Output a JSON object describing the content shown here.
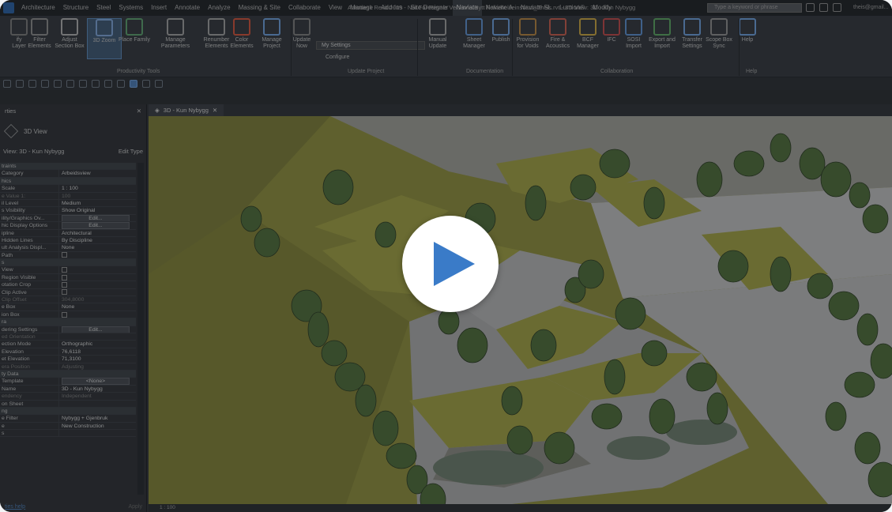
{
  "titlebar": {
    "tabs": [
      "Architecture",
      "Structure",
      "Steel",
      "Systems",
      "Insert",
      "Annotate",
      "Analyze",
      "Massing & Site",
      "Collaborate",
      "View",
      "Manage",
      "Add-Ins",
      "Site Designer",
      "Naviate",
      "Naviate A",
      "Naviate SL",
      "Lumion®",
      "Modify"
    ],
    "active_tab": "Naviate",
    "window_title": "Autodesk Revit 2019 - Not For Resale Version - Nytt Folkehelseinstitutt_Theis.rvt - 3D View: 3D - Kun Nybygg",
    "search_placeholder": "Type a keyword or phrase",
    "user": "theis@gmail..."
  },
  "ribbon": {
    "buttons": [
      {
        "label": "ify\nLayer",
        "icon": "modify-icon"
      },
      {
        "label": "Filter\nElements",
        "icon": "filter-icon"
      },
      {
        "label": "Adjust\nSection Box",
        "icon": "section-box-icon"
      },
      {
        "label": "3D Zoom",
        "icon": "3d-zoom-icon"
      },
      {
        "label": "Place Family",
        "icon": "place-family-icon"
      },
      {
        "label": "Manage\nParameters",
        "icon": "parameters-icon"
      },
      {
        "label": "Renumber\nElements",
        "icon": "renumber-icon"
      },
      {
        "label": "Color\nElements",
        "icon": "color-wheel-icon"
      },
      {
        "label": "Manage\nProject",
        "icon": "gear-icon"
      },
      {
        "label": "Update\nNow",
        "icon": "update-icon"
      },
      {
        "label": "Manual\nUpdate",
        "icon": "manual-update-icon"
      },
      {
        "label": "Sheet\nManager",
        "icon": "sheet-manager-icon"
      },
      {
        "label": "Publish",
        "icon": "publish-icon"
      },
      {
        "label": "Provision\nfor Voids",
        "icon": "provision-icon"
      },
      {
        "label": "Fire &\nAcoustics",
        "icon": "fire-icon"
      },
      {
        "label": "BCF\nManager",
        "icon": "bcf-icon"
      },
      {
        "label": "IFC",
        "icon": "ifc-icon"
      },
      {
        "label": "SOSI\nImport",
        "icon": "sosi-icon"
      },
      {
        "label": "Export and\nImport",
        "icon": "export-import-icon"
      },
      {
        "label": "Transfer\nSettings",
        "icon": "transfer-icon"
      },
      {
        "label": "Scope Box\nSync",
        "icon": "scope-box-icon"
      },
      {
        "label": "Help",
        "icon": "help-icon"
      }
    ],
    "settings_dropdown": "My Settings",
    "configure_label": "Configure",
    "panels": [
      "Productivity Tools",
      "Update Project",
      "Documentation",
      "Collaboration",
      "Help"
    ]
  },
  "properties": {
    "header": "rties",
    "type_name": "3D View",
    "view_selector": "View: 3D - Kun Nybygg",
    "edit_type": "Edit Type",
    "rows": [
      {
        "k": "traints",
        "v": "",
        "group": true
      },
      {
        "k": "Category",
        "v": "Arbeidsview"
      },
      {
        "k": "hics",
        "v": "",
        "group": true
      },
      {
        "k": "Scale",
        "v": "1 : 100"
      },
      {
        "k": "e Value 1:",
        "v": "100",
        "dim": true
      },
      {
        "k": "il Level",
        "v": "Medium"
      },
      {
        "k": "s Visibility",
        "v": "Show Original"
      },
      {
        "k": "ility/Graphics Ov...",
        "v": "Edit...",
        "btn": true
      },
      {
        "k": "hic Display Options",
        "v": "Edit...",
        "btn": true
      },
      {
        "k": "ipline",
        "v": "Architectural"
      },
      {
        "k": "Hidden Lines",
        "v": "By Discipline"
      },
      {
        "k": "ult Analysis Displ...",
        "v": "None"
      },
      {
        "k": "Path",
        "v": "",
        "check": true
      },
      {
        "k": "s",
        "v": "",
        "group": true
      },
      {
        "k": "View",
        "v": "",
        "check": true
      },
      {
        "k": "Region Visible",
        "v": "",
        "check": true
      },
      {
        "k": "otation Crop",
        "v": "",
        "check": true
      },
      {
        "k": "Clip Active",
        "v": "",
        "check": true
      },
      {
        "k": "Clip Offset",
        "v": "304,8000",
        "dim": true
      },
      {
        "k": "e Box",
        "v": "None"
      },
      {
        "k": "ion Box",
        "v": "",
        "check": true
      },
      {
        "k": "ra",
        "v": "",
        "group": true
      },
      {
        "k": "dering Settings",
        "v": "Edit...",
        "btn": true
      },
      {
        "k": "ed Orientation",
        "v": "",
        "dim": true
      },
      {
        "k": "ection Mode",
        "v": "Orthographic"
      },
      {
        "k": "Elevation",
        "v": "76,6118"
      },
      {
        "k": "et Elevation",
        "v": "71,3100"
      },
      {
        "k": "era Position",
        "v": "Adjusting",
        "dim": true
      },
      {
        "k": "ty Data",
        "v": "",
        "group": true
      },
      {
        "k": "Template",
        "v": "<None>",
        "btn": true
      },
      {
        "k": "Name",
        "v": "3D - Kun Nybygg"
      },
      {
        "k": "endency",
        "v": "Independent",
        "dim": true
      },
      {
        "k": "on Sheet",
        "v": ""
      },
      {
        "k": "ng",
        "v": "",
        "group": true
      },
      {
        "k": "e Filter",
        "v": "Nybygg + Gjenbruk"
      },
      {
        "k": "e",
        "v": "New Construction"
      },
      {
        "k": "s",
        "v": ""
      }
    ],
    "help_link": "ties help",
    "apply": "Apply"
  },
  "viewport": {
    "tab_label": "3D - Kun Nybygg",
    "scale": "1 : 100"
  },
  "colors": {
    "grass": "#8a8a3c",
    "paving": "#b4b4b4",
    "tree": "#4e6a3a",
    "play_icon": "#3a7bc8"
  }
}
